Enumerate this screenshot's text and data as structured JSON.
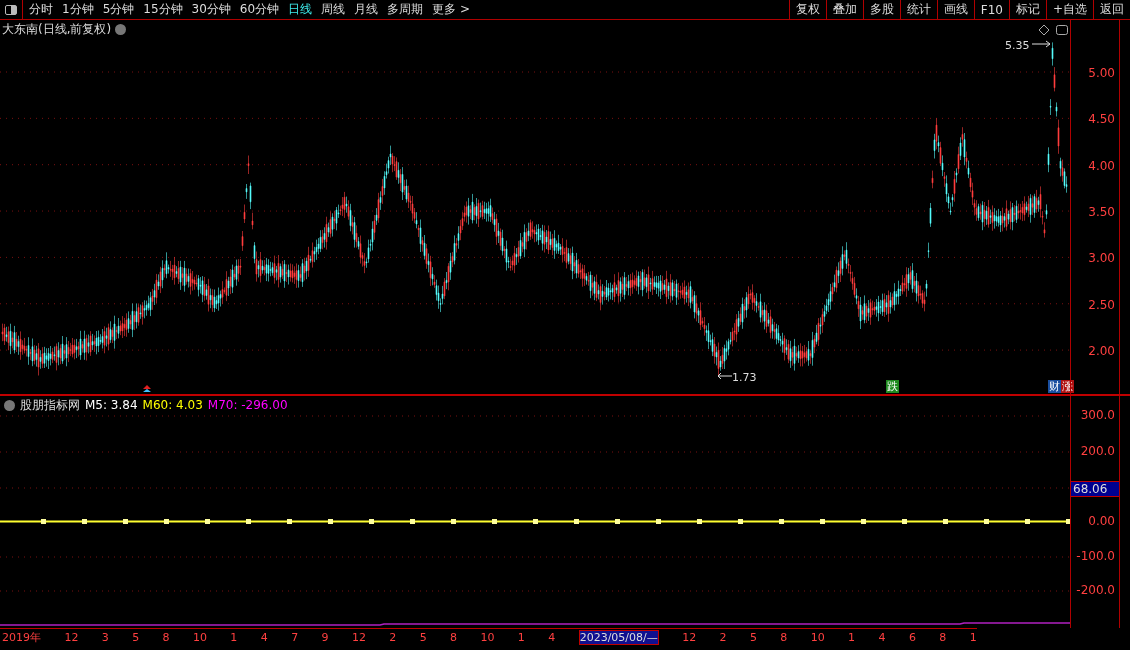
{
  "toolbar": {
    "periods": [
      {
        "label": "分时",
        "selected": false
      },
      {
        "label": "1分钟",
        "selected": false
      },
      {
        "label": "5分钟",
        "selected": false
      },
      {
        "label": "15分钟",
        "selected": false
      },
      {
        "label": "30分钟",
        "selected": false
      },
      {
        "label": "60分钟",
        "selected": false
      },
      {
        "label": "日线",
        "selected": true
      },
      {
        "label": "周线",
        "selected": false
      },
      {
        "label": "月线",
        "selected": false
      },
      {
        "label": "多周期",
        "selected": false
      }
    ],
    "more": "更多 >",
    "actions": [
      "复权",
      "叠加",
      "多股",
      "统计",
      "画线",
      "F10",
      "标记",
      "+自选",
      "返回"
    ]
  },
  "chart": {
    "title": "大东南(日线,前复权)",
    "y_labels": [
      "5.00",
      "4.50",
      "4.00",
      "3.50",
      "3.00",
      "2.50",
      "2.00"
    ],
    "high_label": "5.35",
    "low_label": "1.73",
    "signals": [
      {
        "label": "跌",
        "color": "#1f8a1f"
      },
      {
        "label": "财",
        "color": "#1a4fa0"
      },
      {
        "label": "涨",
        "color": "#b01010"
      }
    ]
  },
  "indicator": {
    "name": "股朋指标网",
    "values": [
      {
        "label": "M5: 3.84",
        "color": "#ffffff"
      },
      {
        "label": "M60: 4.03",
        "color": "#ffff00"
      },
      {
        "label": "M70: -296.00",
        "color": "#ff00ff"
      }
    ],
    "y_labels": [
      "300.0",
      "200.0",
      "0.00",
      "-100.0",
      "-200.0"
    ],
    "current": "68.06"
  },
  "date_axis": [
    {
      "label": "2019年",
      "selected": false
    },
    {
      "label": "12",
      "selected": false
    },
    {
      "label": "3",
      "selected": false
    },
    {
      "label": "5",
      "selected": false
    },
    {
      "label": "8",
      "selected": false
    },
    {
      "label": "10",
      "selected": false
    },
    {
      "label": "1",
      "selected": false
    },
    {
      "label": "4",
      "selected": false
    },
    {
      "label": "7",
      "selected": false
    },
    {
      "label": "9",
      "selected": false
    },
    {
      "label": "12",
      "selected": false
    },
    {
      "label": "2",
      "selected": false
    },
    {
      "label": "5",
      "selected": false
    },
    {
      "label": "8",
      "selected": false
    },
    {
      "label": "10",
      "selected": false
    },
    {
      "label": "1",
      "selected": false
    },
    {
      "label": "4",
      "selected": false
    },
    {
      "label": "2023/05/08/—",
      "selected": true
    },
    {
      "label": "12",
      "selected": false
    },
    {
      "label": "2",
      "selected": false
    },
    {
      "label": "5",
      "selected": false
    },
    {
      "label": "8",
      "selected": false
    },
    {
      "label": "10",
      "selected": false
    },
    {
      "label": "1",
      "selected": false
    },
    {
      "label": "4",
      "selected": false
    },
    {
      "label": "6",
      "selected": false
    },
    {
      "label": "8",
      "selected": false
    },
    {
      "label": "1",
      "selected": false
    }
  ]
}
